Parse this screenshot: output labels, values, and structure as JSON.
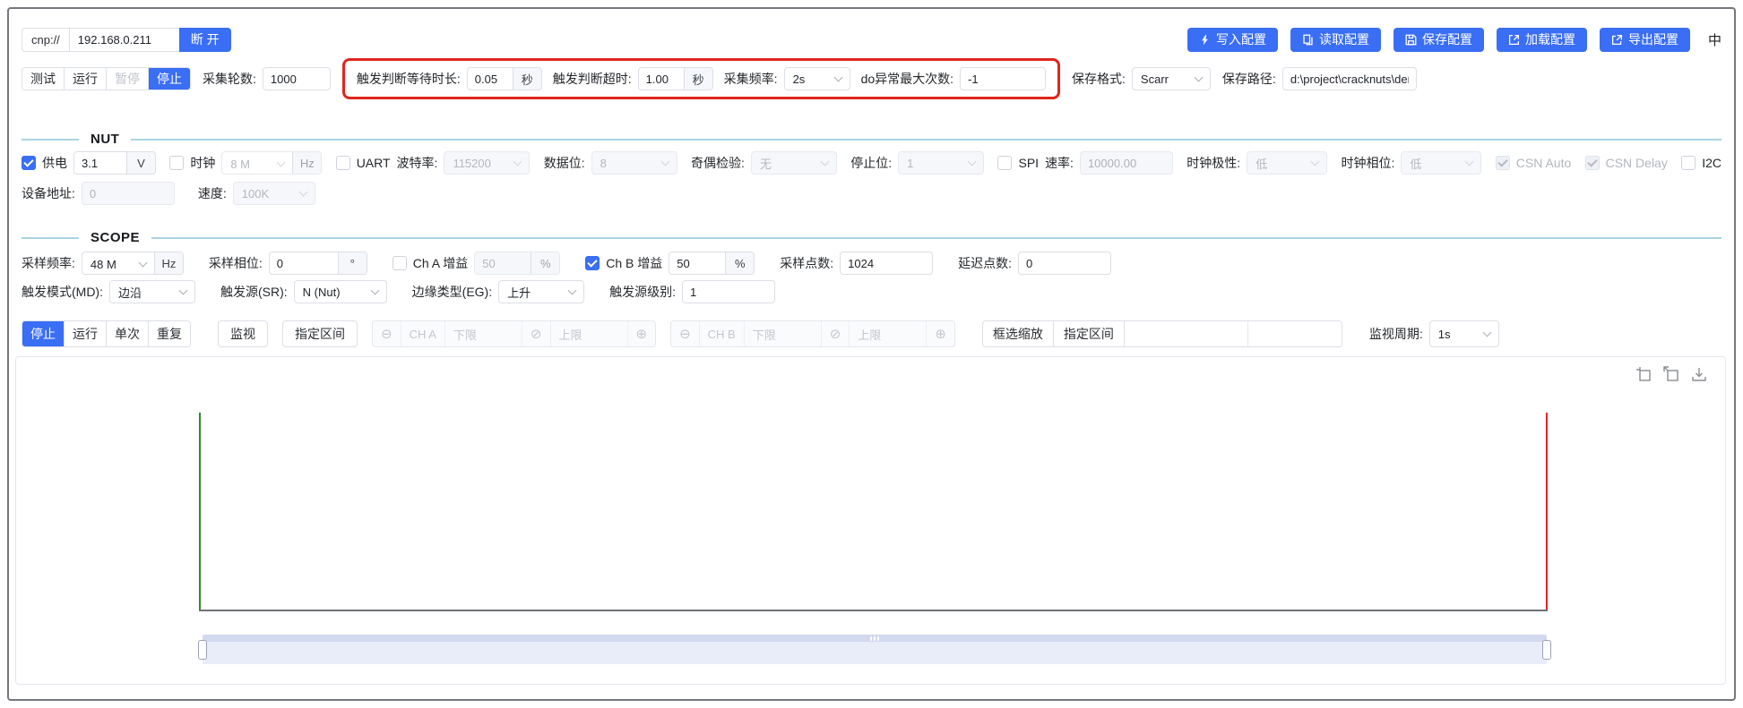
{
  "colors": {
    "accent": "#3a6ef5",
    "alert_border": "#e0261c",
    "section_divider": "#abd3e3",
    "trigger_start_marker": "#2f8a2f",
    "trigger_end_marker": "#e62222"
  },
  "topbar": {
    "protocol": "cnp://",
    "ip": "192.168.0.211",
    "disconnect": "断 开",
    "write": "写入配置",
    "read": "读取配置",
    "save": "保存配置",
    "load": "加载配置",
    "export": "导出配置",
    "lang": "中"
  },
  "acq": {
    "mode_test": "测试",
    "mode_run": "运行",
    "mode_pause": "暂停",
    "mode_stop": "停止",
    "rounds_label": "采集轮数:",
    "rounds": "1000",
    "trigger_wait_label": "触发判断等待时长:",
    "trigger_wait": "0.05",
    "second_unit": "秒",
    "trigger_timeout_label": "触发判断超时:",
    "trigger_timeout": "1.00",
    "freq_label": "采集频率:",
    "freq": "2s",
    "do_error_label": "do异常最大次数:",
    "do_error": "-1",
    "save_format_label": "保存格式:",
    "save_format": "Scarr",
    "save_path_label": "保存路径:",
    "save_path": "d:\\project\\cracknuts\\demo"
  },
  "nut": {
    "title": "NUT",
    "power_label": "供电",
    "power_value": "3.1",
    "power_unit": "V",
    "clock_label": "时钟",
    "clock_value": "8 M",
    "clock_unit": "Hz",
    "uart_label": "UART",
    "baud_label": "波特率:",
    "baud": "115200",
    "databits_label": "数据位:",
    "databits": "8",
    "parity_label": "奇偶检验:",
    "parity": "无",
    "stopbits_label": "停止位:",
    "stopbits": "1",
    "spi_label": "SPI",
    "spi_rate_label": "速率:",
    "spi_rate": "10000.00",
    "cpol_label": "时钟极性:",
    "cpol": "低",
    "cpha_label": "时钟相位:",
    "cpha": "低",
    "csn_auto": "CSN Auto",
    "csn_delay": "CSN Delay",
    "i2c_label": "I2C",
    "addr_label": "设备地址:",
    "addr": "0",
    "speed_label": "速度:",
    "speed": "100K"
  },
  "scope": {
    "title": "SCOPE",
    "freq_label": "采样频率:",
    "freq": "48 M",
    "freq_unit": "Hz",
    "phase_label": "采样相位:",
    "phase": "0",
    "phase_unit": "°",
    "cha_label": "Ch A 增益",
    "cha_gain": "50",
    "percent": "%",
    "chb_label": "Ch B 增益",
    "chb_gain": "50",
    "points_label": "采样点数:",
    "points": "1024",
    "delay_label": "延迟点数:",
    "delay": "0",
    "trig_mode_label": "触发模式(MD):",
    "trig_mode": "边沿",
    "trig_src_label": "触发源(SR):",
    "trig_src": "N (Nut)",
    "edge_label": "边缘类型(EG):",
    "edge": "上升",
    "level_label": "触发源级别:",
    "level": "1"
  },
  "monitor": {
    "stop": "停止",
    "run": "运行",
    "single": "单次",
    "repeat": "重复",
    "watch": "监视",
    "range": "指定区间",
    "cha": "CH A",
    "chb": "CH B",
    "lower": "下限",
    "upper": "上限",
    "box_zoom": "框选缩放",
    "zoom_range": "指定区间",
    "period_label": "监视周期:",
    "period": "1s"
  }
}
